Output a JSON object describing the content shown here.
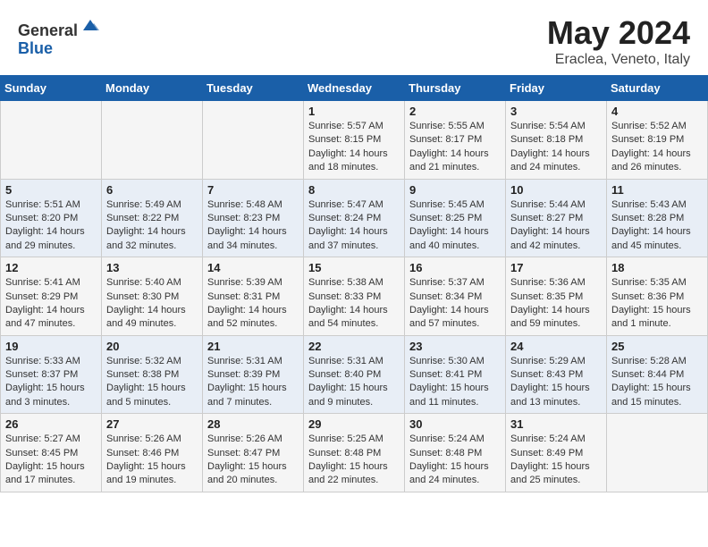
{
  "header": {
    "logo_general": "General",
    "logo_blue": "Blue",
    "title": "May 2024",
    "subtitle": "Eraclea, Veneto, Italy"
  },
  "days_of_week": [
    "Sunday",
    "Monday",
    "Tuesday",
    "Wednesday",
    "Thursday",
    "Friday",
    "Saturday"
  ],
  "weeks": [
    [
      {
        "day": "",
        "info": ""
      },
      {
        "day": "",
        "info": ""
      },
      {
        "day": "",
        "info": ""
      },
      {
        "day": "1",
        "info": "Sunrise: 5:57 AM\nSunset: 8:15 PM\nDaylight: 14 hours and 18 minutes."
      },
      {
        "day": "2",
        "info": "Sunrise: 5:55 AM\nSunset: 8:17 PM\nDaylight: 14 hours and 21 minutes."
      },
      {
        "day": "3",
        "info": "Sunrise: 5:54 AM\nSunset: 8:18 PM\nDaylight: 14 hours and 24 minutes."
      },
      {
        "day": "4",
        "info": "Sunrise: 5:52 AM\nSunset: 8:19 PM\nDaylight: 14 hours and 26 minutes."
      }
    ],
    [
      {
        "day": "5",
        "info": "Sunrise: 5:51 AM\nSunset: 8:20 PM\nDaylight: 14 hours and 29 minutes."
      },
      {
        "day": "6",
        "info": "Sunrise: 5:49 AM\nSunset: 8:22 PM\nDaylight: 14 hours and 32 minutes."
      },
      {
        "day": "7",
        "info": "Sunrise: 5:48 AM\nSunset: 8:23 PM\nDaylight: 14 hours and 34 minutes."
      },
      {
        "day": "8",
        "info": "Sunrise: 5:47 AM\nSunset: 8:24 PM\nDaylight: 14 hours and 37 minutes."
      },
      {
        "day": "9",
        "info": "Sunrise: 5:45 AM\nSunset: 8:25 PM\nDaylight: 14 hours and 40 minutes."
      },
      {
        "day": "10",
        "info": "Sunrise: 5:44 AM\nSunset: 8:27 PM\nDaylight: 14 hours and 42 minutes."
      },
      {
        "day": "11",
        "info": "Sunrise: 5:43 AM\nSunset: 8:28 PM\nDaylight: 14 hours and 45 minutes."
      }
    ],
    [
      {
        "day": "12",
        "info": "Sunrise: 5:41 AM\nSunset: 8:29 PM\nDaylight: 14 hours and 47 minutes."
      },
      {
        "day": "13",
        "info": "Sunrise: 5:40 AM\nSunset: 8:30 PM\nDaylight: 14 hours and 49 minutes."
      },
      {
        "day": "14",
        "info": "Sunrise: 5:39 AM\nSunset: 8:31 PM\nDaylight: 14 hours and 52 minutes."
      },
      {
        "day": "15",
        "info": "Sunrise: 5:38 AM\nSunset: 8:33 PM\nDaylight: 14 hours and 54 minutes."
      },
      {
        "day": "16",
        "info": "Sunrise: 5:37 AM\nSunset: 8:34 PM\nDaylight: 14 hours and 57 minutes."
      },
      {
        "day": "17",
        "info": "Sunrise: 5:36 AM\nSunset: 8:35 PM\nDaylight: 14 hours and 59 minutes."
      },
      {
        "day": "18",
        "info": "Sunrise: 5:35 AM\nSunset: 8:36 PM\nDaylight: 15 hours and 1 minute."
      }
    ],
    [
      {
        "day": "19",
        "info": "Sunrise: 5:33 AM\nSunset: 8:37 PM\nDaylight: 15 hours and 3 minutes."
      },
      {
        "day": "20",
        "info": "Sunrise: 5:32 AM\nSunset: 8:38 PM\nDaylight: 15 hours and 5 minutes."
      },
      {
        "day": "21",
        "info": "Sunrise: 5:31 AM\nSunset: 8:39 PM\nDaylight: 15 hours and 7 minutes."
      },
      {
        "day": "22",
        "info": "Sunrise: 5:31 AM\nSunset: 8:40 PM\nDaylight: 15 hours and 9 minutes."
      },
      {
        "day": "23",
        "info": "Sunrise: 5:30 AM\nSunset: 8:41 PM\nDaylight: 15 hours and 11 minutes."
      },
      {
        "day": "24",
        "info": "Sunrise: 5:29 AM\nSunset: 8:43 PM\nDaylight: 15 hours and 13 minutes."
      },
      {
        "day": "25",
        "info": "Sunrise: 5:28 AM\nSunset: 8:44 PM\nDaylight: 15 hours and 15 minutes."
      }
    ],
    [
      {
        "day": "26",
        "info": "Sunrise: 5:27 AM\nSunset: 8:45 PM\nDaylight: 15 hours and 17 minutes."
      },
      {
        "day": "27",
        "info": "Sunrise: 5:26 AM\nSunset: 8:46 PM\nDaylight: 15 hours and 19 minutes."
      },
      {
        "day": "28",
        "info": "Sunrise: 5:26 AM\nSunset: 8:47 PM\nDaylight: 15 hours and 20 minutes."
      },
      {
        "day": "29",
        "info": "Sunrise: 5:25 AM\nSunset: 8:48 PM\nDaylight: 15 hours and 22 minutes."
      },
      {
        "day": "30",
        "info": "Sunrise: 5:24 AM\nSunset: 8:48 PM\nDaylight: 15 hours and 24 minutes."
      },
      {
        "day": "31",
        "info": "Sunrise: 5:24 AM\nSunset: 8:49 PM\nDaylight: 15 hours and 25 minutes."
      },
      {
        "day": "",
        "info": ""
      }
    ]
  ]
}
